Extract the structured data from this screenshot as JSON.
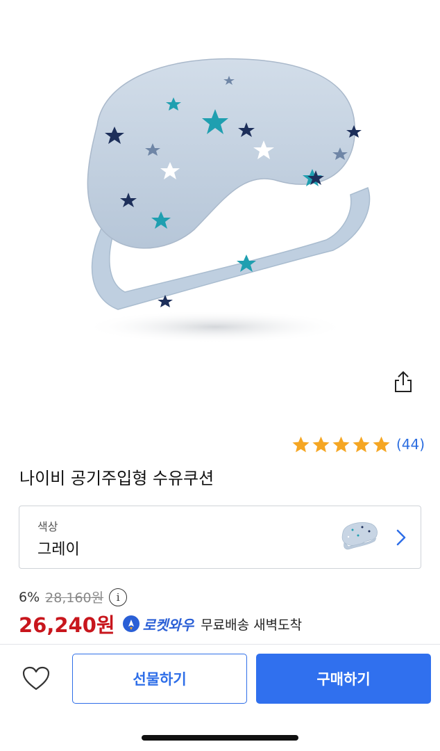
{
  "product": {
    "title": "나이비 공기주입형 수유쿠션",
    "image_icon": "nursing-cushion-image",
    "rating": 5,
    "review_count": "(44)"
  },
  "icons": {
    "share": "share-icon",
    "star": "star-icon",
    "info": "info-icon",
    "rocket": "rocket-icon",
    "heart": "heart-icon",
    "chevron": "chevron-right-icon"
  },
  "option": {
    "label": "색상",
    "value": "그레이"
  },
  "pricing": {
    "discount": "6%",
    "original_price": "28,160원",
    "info_glyph": "i",
    "sale_price": "26,240원",
    "rocket_label": "로켓와우",
    "delivery": "무료배송 새벽도착"
  },
  "actions": {
    "gift_label": "선물하기",
    "buy_label": "구매하기"
  },
  "colors": {
    "accent": "#3070ee",
    "price_red": "#c8161d",
    "star_yellow": "#f5a623",
    "link_blue": "#2b6de0"
  }
}
